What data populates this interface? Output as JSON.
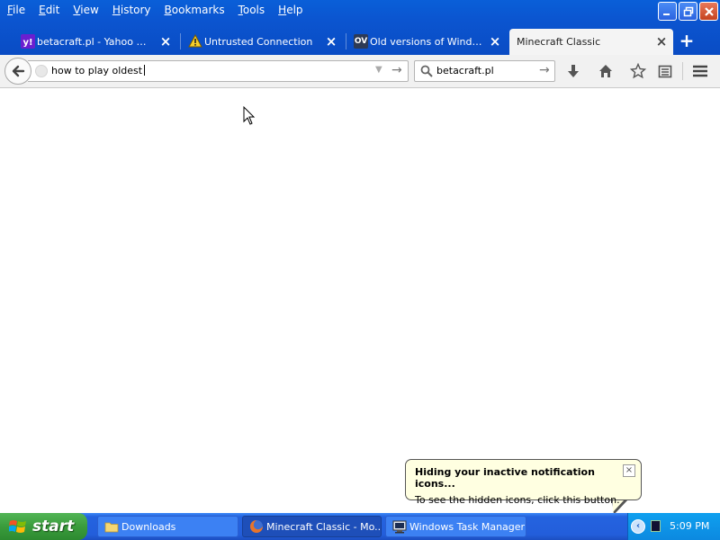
{
  "menu": [
    {
      "label": "File",
      "accel": "F",
      "rest": "ile"
    },
    {
      "label": "Edit",
      "accel": "E",
      "rest": "dit"
    },
    {
      "label": "View",
      "accel": "V",
      "rest": "iew"
    },
    {
      "label": "History",
      "accel": "H",
      "rest": "istory"
    },
    {
      "label": "Bookmarks",
      "accel": "B",
      "rest": "ookmarks"
    },
    {
      "label": "Tools",
      "accel": "T",
      "rest": "ools"
    },
    {
      "label": "Help",
      "accel": "H",
      "rest": "elp"
    }
  ],
  "tabs": [
    {
      "title": "betacraft.pl - Yahoo Search Results",
      "icon": "yahoo-icon",
      "active": false
    },
    {
      "title": "Untrusted Connection",
      "icon": "warning-icon",
      "active": false
    },
    {
      "title": "Old versions of Windows",
      "icon": "ov-icon",
      "active": false
    },
    {
      "title": "Minecraft Classic",
      "icon": "",
      "active": true
    }
  ],
  "ov_label": "OV",
  "nav": {
    "url_value": "how to play oldest",
    "search_value": "betacraft.pl"
  },
  "balloon": {
    "title": "Hiding your inactive notification icons...",
    "body": "To see the hidden icons, click this button.",
    "close": "×"
  },
  "taskbar": {
    "start_label": "start",
    "items": [
      {
        "label": "Downloads",
        "icon": "folder-icon",
        "active": false
      },
      {
        "label": "Minecraft Classic - Mo...",
        "icon": "firefox-icon",
        "active": true
      },
      {
        "label": "Windows Task Manager",
        "icon": "task-manager-icon",
        "active": false
      }
    ],
    "clock": "5:09 PM"
  },
  "colors": {
    "titlebar_blue": "#0b55d0",
    "taskbar_blue": "#235edb",
    "start_green": "#3a9c3c",
    "balloon_bg": "#ffffe1"
  }
}
